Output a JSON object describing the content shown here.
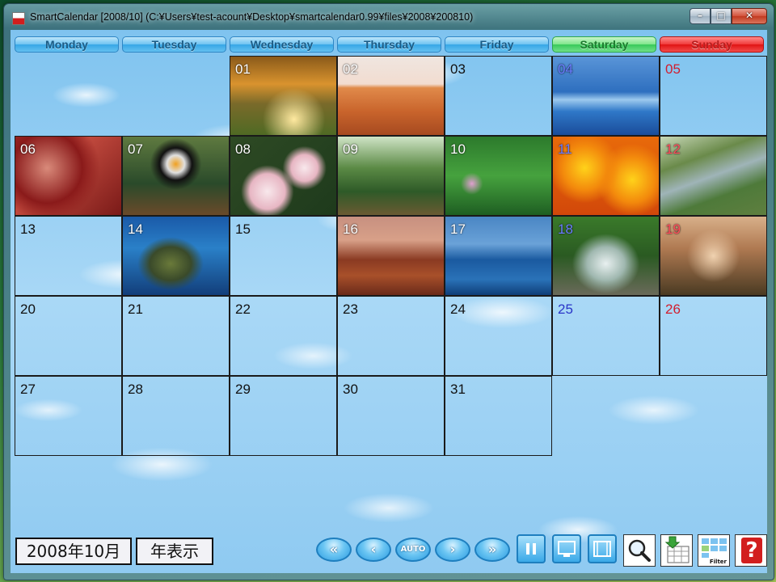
{
  "window": {
    "title": "SmartCalendar [2008/10] (C:¥Users¥test-acount¥Desktop¥smartcalendar0.99¥files¥2008¥200810)",
    "app_icon_text": "SMART"
  },
  "window_controls": {
    "minimize": "–",
    "maximize": "□",
    "close": "✕"
  },
  "weekdays": [
    {
      "label": "Monday",
      "kind": "weekday"
    },
    {
      "label": "Tuesday",
      "kind": "weekday"
    },
    {
      "label": "Wednesday",
      "kind": "weekday"
    },
    {
      "label": "Thursday",
      "kind": "weekday"
    },
    {
      "label": "Friday",
      "kind": "weekday"
    },
    {
      "label": "Saturday",
      "kind": "sat"
    },
    {
      "label": "Sunday",
      "kind": "sun"
    }
  ],
  "calendar": {
    "first_weekday_index": 2,
    "days": [
      {
        "n": "01",
        "photo": "autumn-tree"
      },
      {
        "n": "02",
        "photo": "desert-oryx"
      },
      {
        "n": "03",
        "photo": null
      },
      {
        "n": "04",
        "photo": "ocean-pier"
      },
      {
        "n": "05",
        "photo": null
      },
      {
        "n": "06",
        "photo": "frosted-leaves"
      },
      {
        "n": "07",
        "photo": "toucan"
      },
      {
        "n": "08",
        "photo": "frangipani"
      },
      {
        "n": "09",
        "photo": "forest-path"
      },
      {
        "n": "10",
        "photo": "green-plants"
      },
      {
        "n": "11",
        "photo": "orange-flowers"
      },
      {
        "n": "12",
        "photo": "stream-valley"
      },
      {
        "n": "13",
        "photo": null
      },
      {
        "n": "14",
        "photo": "sea-turtle"
      },
      {
        "n": "15",
        "photo": null
      },
      {
        "n": "16",
        "photo": "monument-valley"
      },
      {
        "n": "17",
        "photo": "whale-tail"
      },
      {
        "n": "18",
        "photo": "waterfall"
      },
      {
        "n": "19",
        "photo": "sunset-trees"
      },
      {
        "n": "20",
        "photo": null
      },
      {
        "n": "21",
        "photo": null
      },
      {
        "n": "22",
        "photo": null
      },
      {
        "n": "23",
        "photo": null
      },
      {
        "n": "24",
        "photo": null
      },
      {
        "n": "25",
        "photo": null
      },
      {
        "n": "26",
        "photo": null
      },
      {
        "n": "27",
        "photo": null
      },
      {
        "n": "28",
        "photo": null
      },
      {
        "n": "29",
        "photo": null
      },
      {
        "n": "30",
        "photo": null
      },
      {
        "n": "31",
        "photo": null
      }
    ]
  },
  "footer": {
    "month_label": "2008年10月",
    "year_view_label": "年表示",
    "nav": {
      "first": "«",
      "prev": "‹",
      "auto": "AUTO",
      "next": "›",
      "last": "»"
    },
    "tools": {
      "zoom_icon": "magnifier-icon",
      "download_icon": "download-grid-icon",
      "filter_label": "Filter",
      "help_label": "?"
    }
  },
  "colors": {
    "weekday_header": "#4fb6ee",
    "saturday_header": "#5fd97a",
    "sunday_header": "#ee2a2a",
    "saturday_number": "#2a35c8",
    "sunday_number": "#d21e2e"
  }
}
